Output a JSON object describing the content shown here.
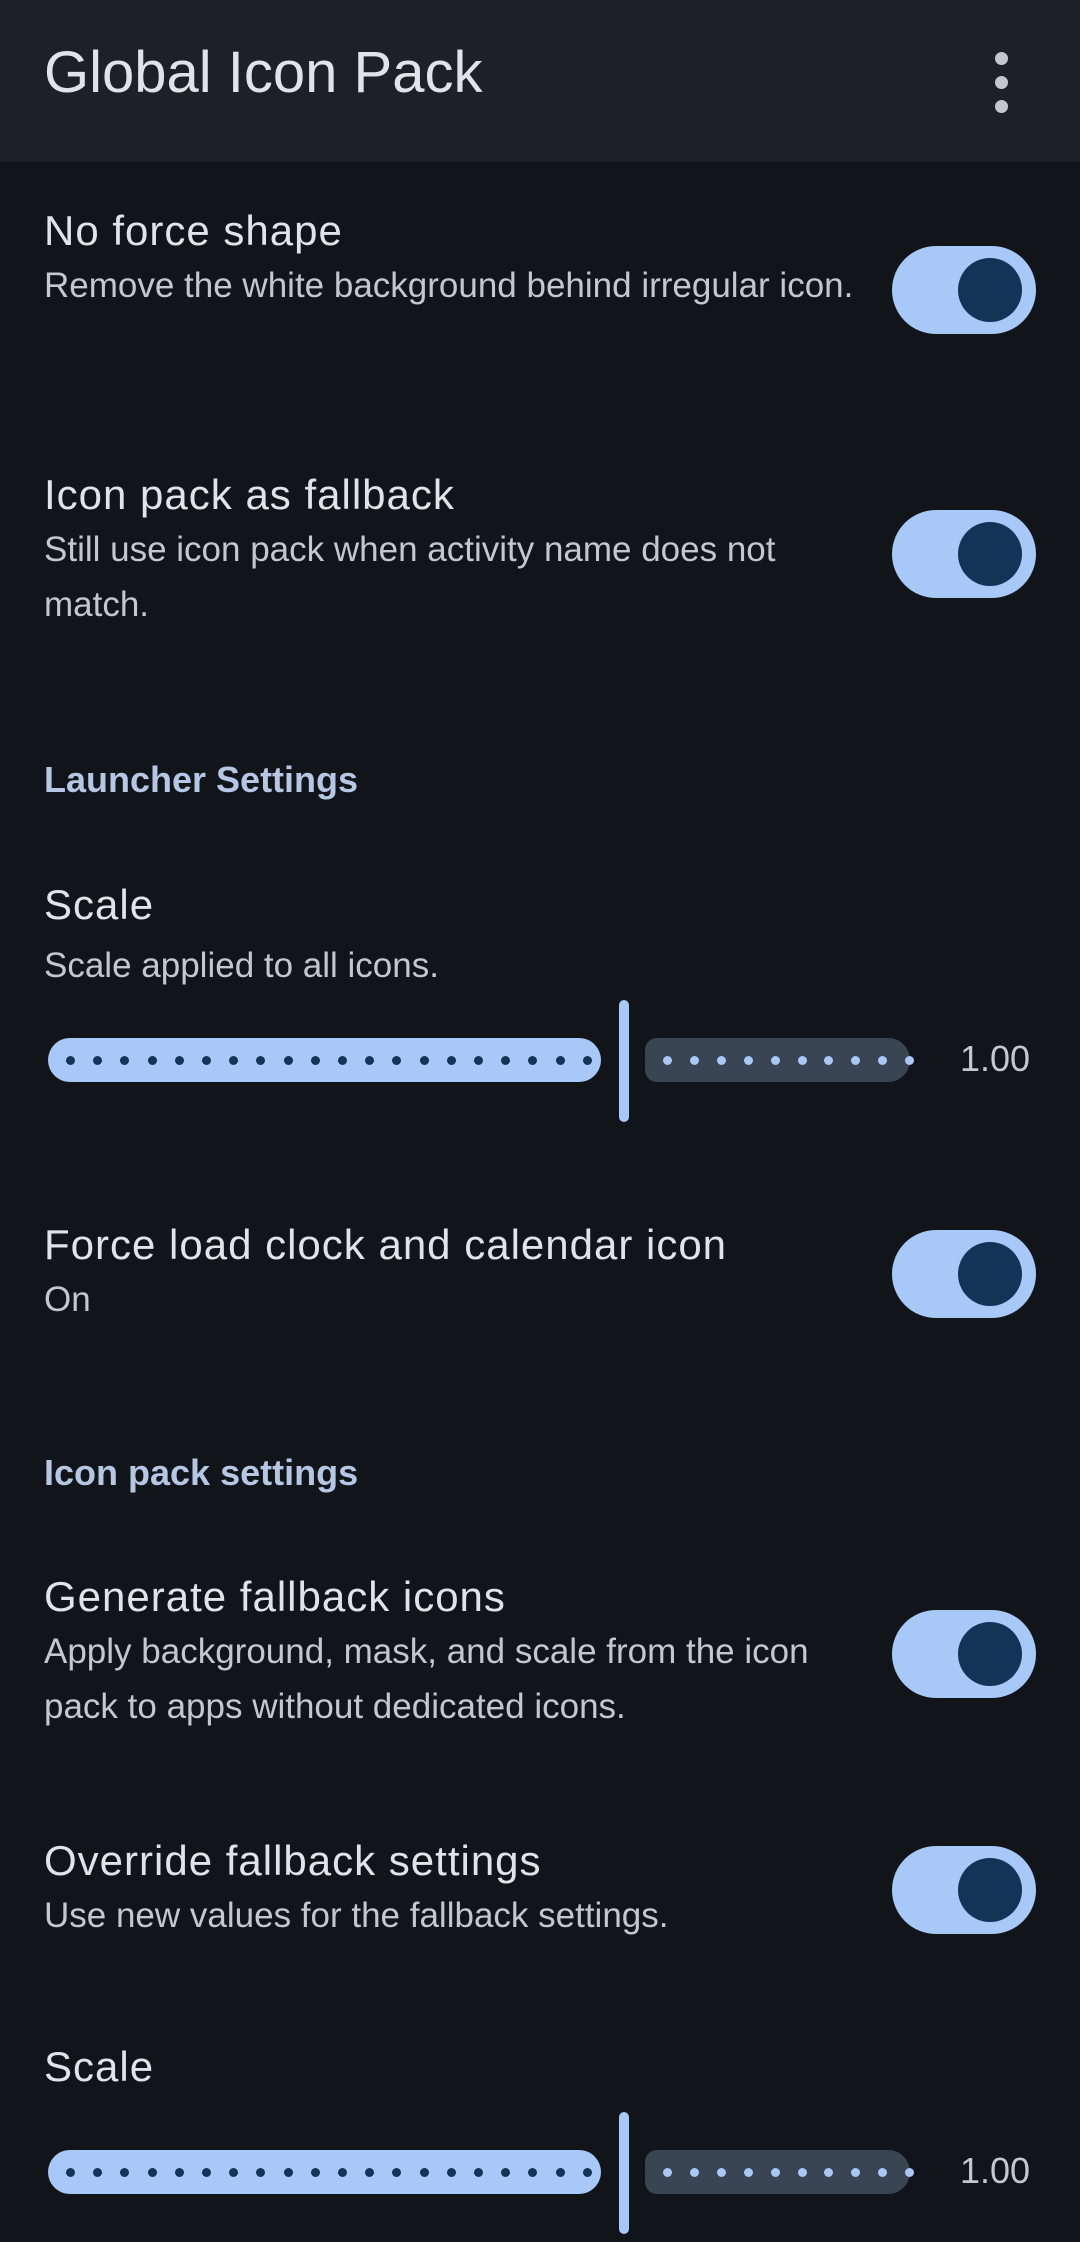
{
  "app_bar": {
    "title": "Global Icon Pack",
    "menu_icon": "more-vert-icon"
  },
  "preferences": {
    "no_force_shape": {
      "title": "No force shape",
      "summary": "Remove the white background behind irregular icon.",
      "checked": true
    },
    "icon_pack_fallback": {
      "title": "Icon pack as fallback",
      "summary": "Still use icon pack when activity name does not match.",
      "checked": true
    },
    "launcher_section": "Launcher Settings",
    "launcher_scale": {
      "title": "Scale",
      "summary": "Scale applied to all icons.",
      "value": "1.00"
    },
    "force_clock": {
      "title": "Force load clock and calendar icon",
      "summary": "On",
      "checked": true
    },
    "icon_pack_section": "Icon pack settings",
    "generate_fallback": {
      "title": "Generate fallback icons",
      "summary": "Apply background, mask, and scale from the icon pack to apps without dedicated icons.",
      "checked": true
    },
    "override_fallback": {
      "title": "Override fallback settings",
      "summary": "Use new values for the fallback settings.",
      "checked": true
    },
    "fallback_scale": {
      "title": "Scale",
      "value": "1.00"
    }
  },
  "colors": {
    "background": "#111418",
    "app_bar": "#1d2024",
    "accent": "#a8c8f7",
    "switch_thumb": "#123456"
  }
}
